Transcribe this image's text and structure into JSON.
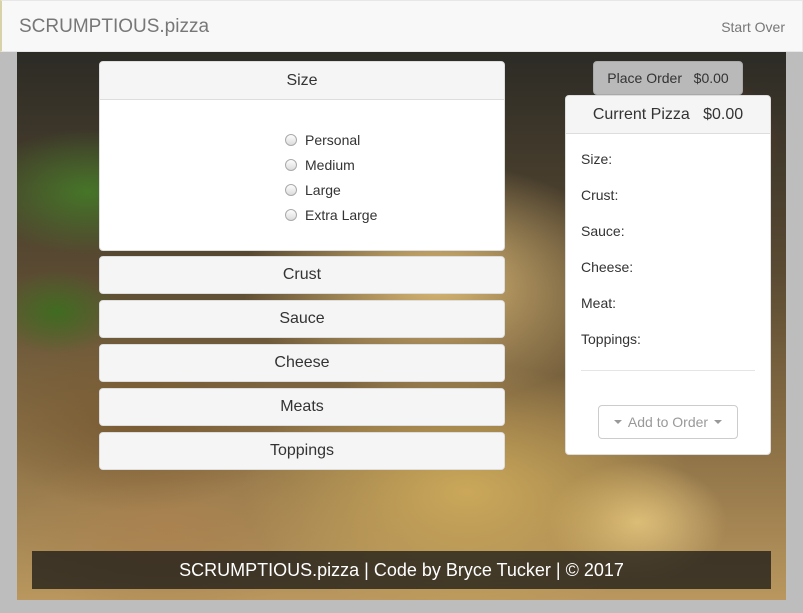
{
  "nav": {
    "brand": "SCRUMPTIOUS.pizza",
    "start_over": "Start Over"
  },
  "size_panel": {
    "title": "Size",
    "options": [
      "Personal",
      "Medium",
      "Large",
      "Extra Large"
    ]
  },
  "categories": [
    "Crust",
    "Sauce",
    "Cheese",
    "Meats",
    "Toppings"
  ],
  "place_order": {
    "label": "Place Order",
    "amount": "$0.00"
  },
  "current_pizza": {
    "title": "Current Pizza",
    "amount": "$0.00",
    "fields": [
      "Size:",
      "Crust:",
      "Sauce:",
      "Cheese:",
      "Meat:",
      "Toppings:"
    ],
    "add_button": "Add to Order"
  },
  "footer": {
    "text": "SCRUMPTIOUS.pizza | Code by Bryce Tucker | © 2017"
  }
}
